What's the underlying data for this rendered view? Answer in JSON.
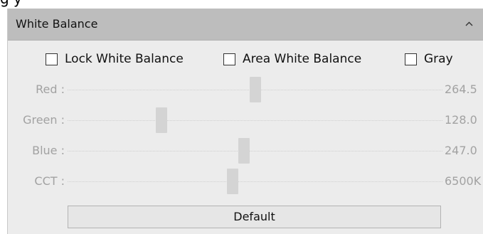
{
  "caption": "g                                          y",
  "panel": {
    "title": "White Balance",
    "collapse_icon": "chevron-up-icon"
  },
  "checkboxes": [
    {
      "label": "Lock White Balance",
      "checked": false
    },
    {
      "label": "Area White Balance",
      "checked": false
    },
    {
      "label": "Gray",
      "checked": false
    }
  ],
  "sliders": [
    {
      "label": "Red :",
      "value": "264.5",
      "level": 0.5
    },
    {
      "label": "Green :",
      "value": "128.0",
      "level": 0.25
    },
    {
      "label": "Blue :",
      "value": "247.0",
      "level": 0.47
    },
    {
      "label": "CCT :",
      "value": "6500K",
      "level": 0.44
    }
  ],
  "default_label": "Default"
}
